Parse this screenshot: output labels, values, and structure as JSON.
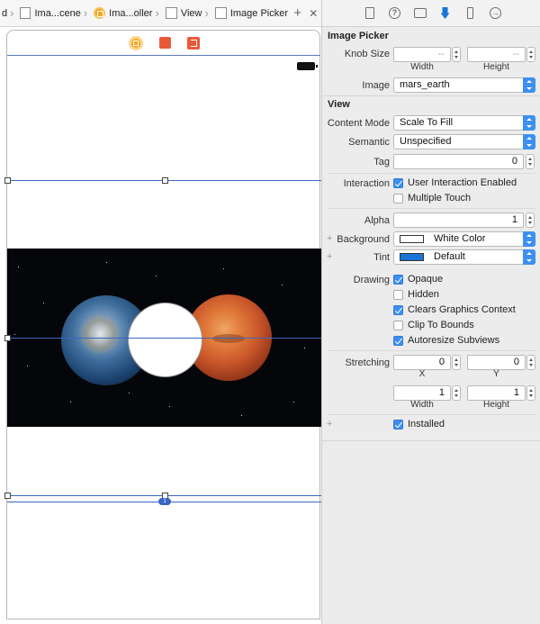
{
  "jumpbar": {
    "crumbs": [
      {
        "label": "d"
      },
      {
        "label": "Ima...cene"
      },
      {
        "label": "Ima...oller"
      },
      {
        "label": "View"
      },
      {
        "label": "Image Picker"
      }
    ],
    "add_symbol": "+",
    "close_symbol": "✕"
  },
  "inspector": {
    "tabs": [
      "file-inspector",
      "quick-help",
      "identity-inspector",
      "attributes-inspector",
      "size-inspector",
      "connections-inspector"
    ],
    "tab_glyphs": {
      "help": "?",
      "connections": "→"
    },
    "image_picker": {
      "title": "Image Picker",
      "knob_size_label": "Knob Size",
      "width_placeholder": "--",
      "height_placeholder": "--",
      "width_label": "Width",
      "height_label": "Height",
      "image_label": "Image",
      "image_value": "mars_earth"
    },
    "view": {
      "title": "View",
      "content_mode_label": "Content Mode",
      "content_mode_value": "Scale To Fill",
      "semantic_label": "Semantic",
      "semantic_value": "Unspecified",
      "tag_label": "Tag",
      "tag_value": "0",
      "interaction_label": "Interaction",
      "user_interaction_label": "User Interaction Enabled",
      "user_interaction_checked": true,
      "multiple_touch_label": "Multiple Touch",
      "multiple_touch_checked": false,
      "alpha_label": "Alpha",
      "alpha_value": "1",
      "background_label": "Background",
      "background_value": "White Color",
      "background_color": "#ffffff",
      "tint_label": "Tint",
      "tint_value": "Default",
      "tint_color": "#1b74d8",
      "drawing_label": "Drawing",
      "opaque_label": "Opaque",
      "opaque_checked": true,
      "hidden_label": "Hidden",
      "hidden_checked": false,
      "clears_label": "Clears Graphics Context",
      "clears_checked": true,
      "clip_label": "Clip To Bounds",
      "clip_checked": false,
      "autoresize_label": "Autoresize Subviews",
      "autoresize_checked": true,
      "stretching_label": "Stretching",
      "stretch_x": "0",
      "stretch_y": "0",
      "x_label": "X",
      "y_label": "Y",
      "stretch_width": "1",
      "stretch_height": "1",
      "width_label": "Width",
      "height_label": "Height",
      "installed_label": "Installed",
      "installed_checked": true
    },
    "plus_symbol": "+"
  },
  "canvas": {
    "image_name": "mars_earth",
    "constraint_badge": "1"
  }
}
